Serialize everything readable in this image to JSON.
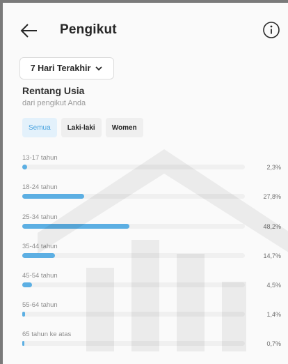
{
  "header": {
    "title": "Pengikut",
    "back_icon": "arrow-left-icon",
    "info_icon": "info-icon"
  },
  "filter": {
    "range_label": "7 Hari Terakhir",
    "range_icon": "chevron-down-icon"
  },
  "section": {
    "title": "Rentang Usia",
    "subtitle": "dari pengikut Anda"
  },
  "chips": [
    {
      "label": "Semua",
      "active": true
    },
    {
      "label": "Laki-laki",
      "active": false
    },
    {
      "label": "Women",
      "active": false
    }
  ],
  "colors": {
    "bar": "#5cafe3",
    "chip_active_bg": "#e3f1fb",
    "chip_active_text": "#4aa3df"
  },
  "age_rows": [
    {
      "label": "13-17 tahun",
      "value": "2,3%",
      "percent": 2.3
    },
    {
      "label": "18-24 tahun",
      "value": "27,8%",
      "percent": 27.8
    },
    {
      "label": "25-34 tahun",
      "value": "48,2%",
      "percent": 48.2
    },
    {
      "label": "35-44 tahun",
      "value": "14,7%",
      "percent": 14.7
    },
    {
      "label": "45-54 tahun",
      "value": "4,5%",
      "percent": 4.5
    },
    {
      "label": "55-64 tahun",
      "value": "1,4%",
      "percent": 1.4
    },
    {
      "label": "65 tahun ke atas",
      "value": "0,7%",
      "percent": 0.7
    }
  ]
}
